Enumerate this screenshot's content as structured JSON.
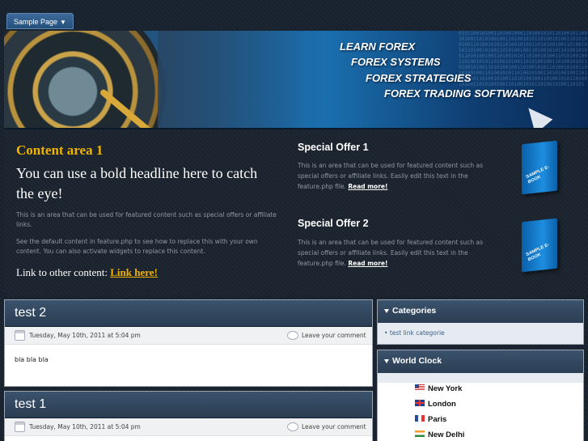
{
  "nav": {
    "item_label": "Sample Page"
  },
  "banner": {
    "lines": [
      "LEARN FOREX",
      "FOREX SYSTEMS",
      "FOREX STRATEGIES",
      "FOREX TRADING SOFTWARE"
    ]
  },
  "content_area": {
    "title": "Content area 1",
    "headline": "You can use a bold headline here to catch the eye!",
    "para1": "This is an area that can be used for featured content such as special offers or affiliate links.",
    "para2": "See the default content in feature.php to see how to replace this with your own content. You can also activate widgets to replace this content.",
    "link_prefix": "Link to other content:",
    "link_label": "Link here!"
  },
  "offers": [
    {
      "title": "Special Offer 1",
      "text": "This is an area that can be used for featured content such as special offers or affiliate links. Easily edit this text in the feature.php file.",
      "link": "Read more!",
      "ebook_label": "SAMPLE E-BOOK"
    },
    {
      "title": "Special Offer 2",
      "text": "This is an area that can be used for featured content such as special offers or affiliate links. Easily edit this text in the feature.php file.",
      "link": "Read more!",
      "ebook_label": "SAMPLE E-BOOK"
    }
  ],
  "posts": [
    {
      "title": "test 2",
      "date": "Tuesday, May 10th, 2011 at 5:04 pm",
      "comment_link": "Leave your comment",
      "body": "bla bla bla"
    },
    {
      "title": "test 1",
      "date": "Tuesday, May 10th, 2011 at 5:04 pm",
      "comment_link": "Leave your comment"
    }
  ],
  "sidebar": {
    "categories": {
      "title": "Categories",
      "items": [
        "test link categorie"
      ]
    },
    "world_clock": {
      "title": "World Clock",
      "cities": [
        "New York",
        "London",
        "Paris",
        "New Delhi"
      ]
    }
  }
}
